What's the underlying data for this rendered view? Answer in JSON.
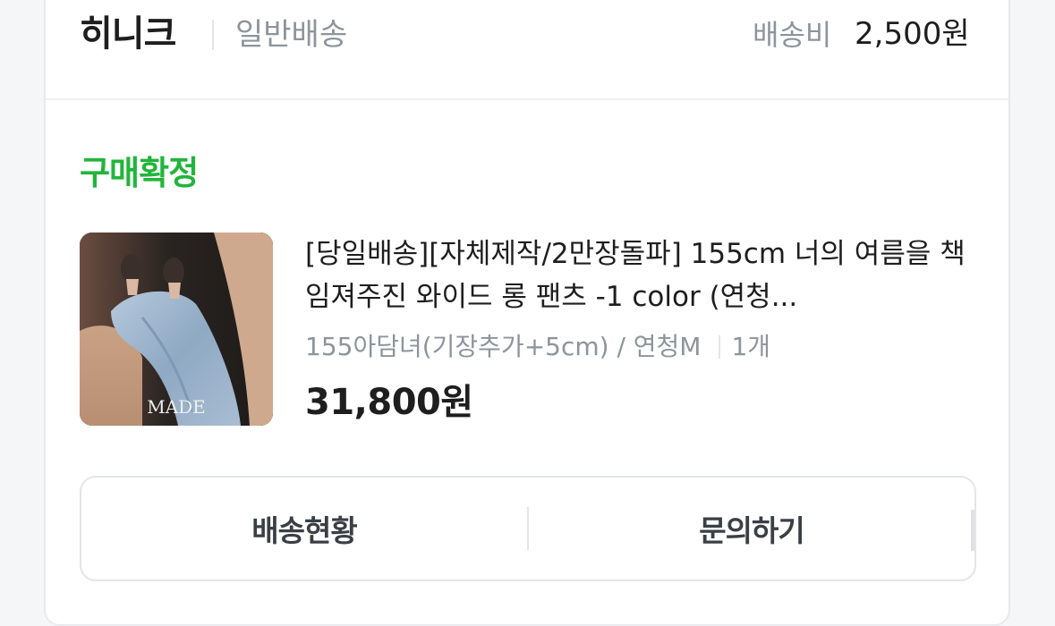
{
  "header": {
    "seller_name": "히니크",
    "shipping_type": "일반배송",
    "fee_label": "배송비",
    "fee_value": "2,500원"
  },
  "order": {
    "status": "구매확정",
    "status_color": "#21b53b",
    "product_title": "[당일배송][자체제작/2만장돌파] 155cm 너의 여름을 책임져주진 와이드 롱 팬츠 -1 color (연청...",
    "option": "155아담녀(기장추가+5cm) / 연청M",
    "quantity": "1개",
    "price": "31,800원",
    "thumbnail_text": "MADE"
  },
  "actions": {
    "track_label": "배송현황",
    "inquiry_label": "문의하기"
  }
}
